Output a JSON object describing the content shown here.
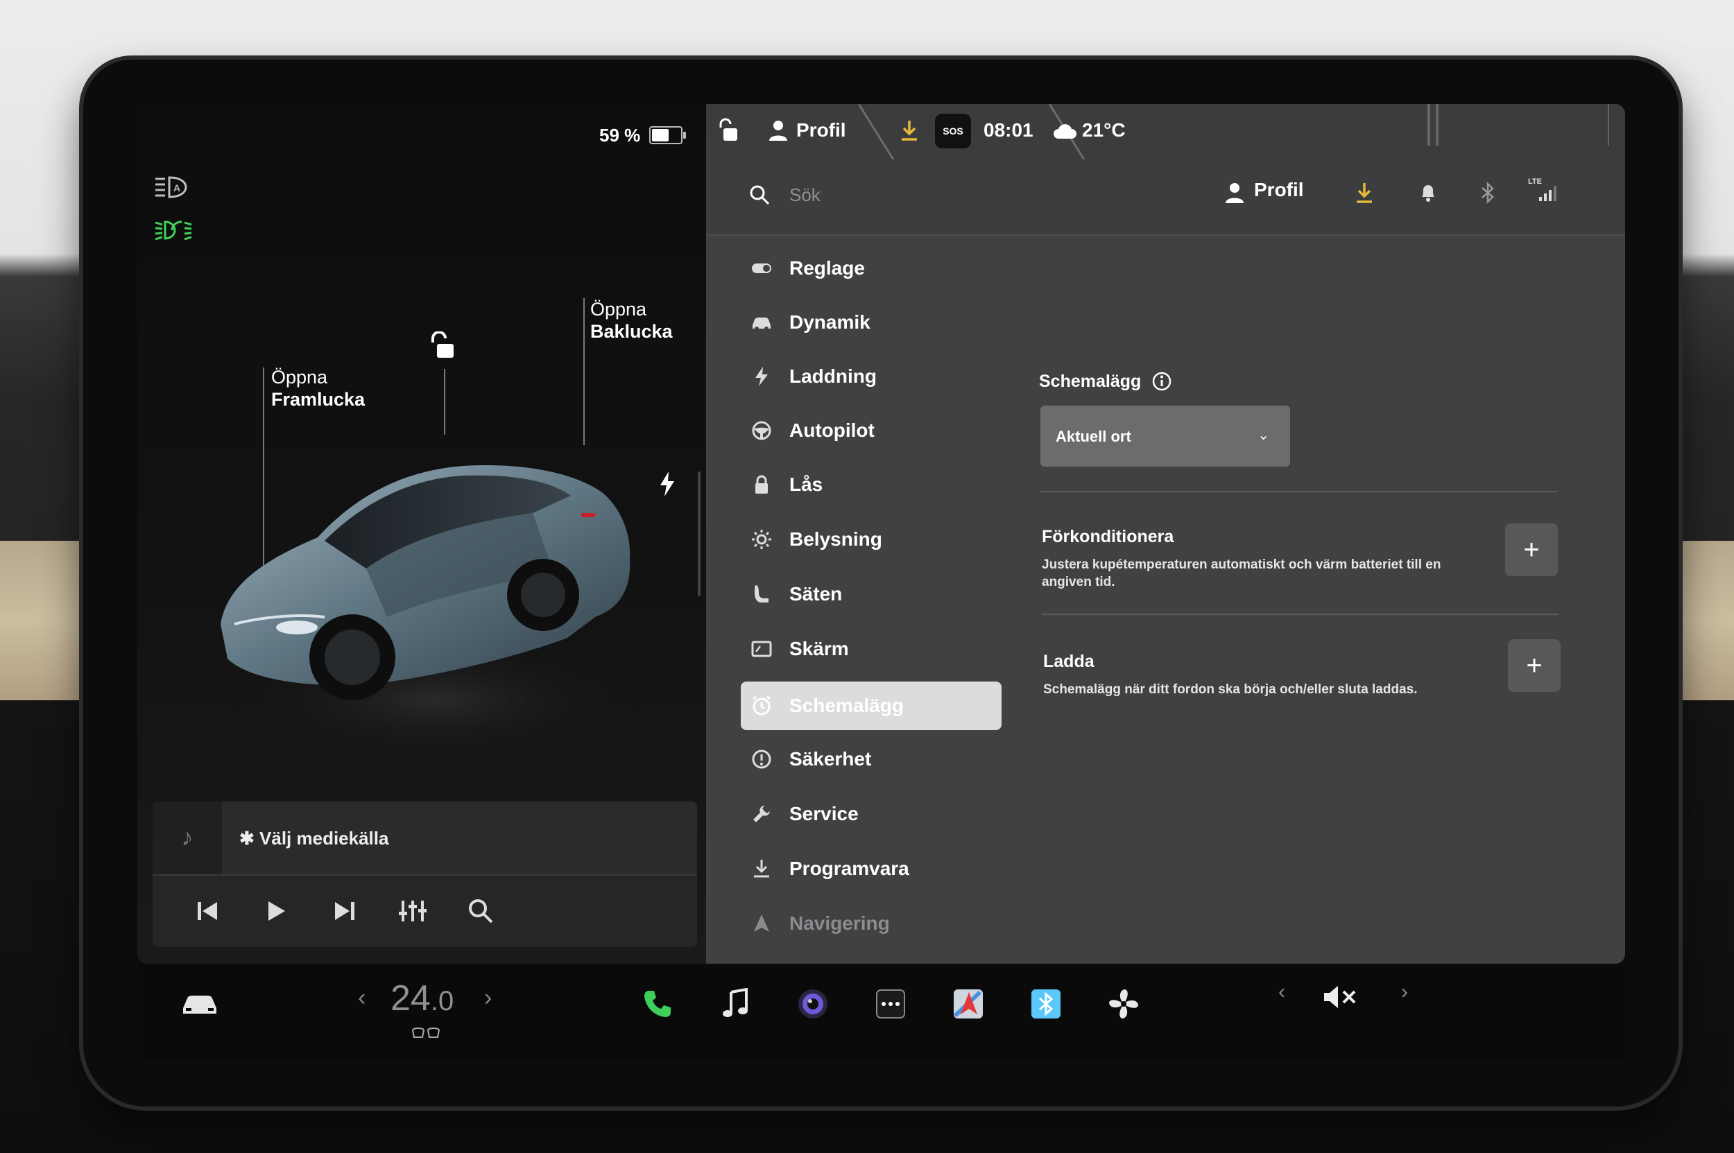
{
  "status_bar": {
    "battery_percent": "59 %",
    "battery_level": 0.59,
    "profile_label": "Profil",
    "sos_label": "SOS",
    "time": "08:01",
    "outside_temp": "21°C"
  },
  "car_panel": {
    "front_trunk_label_line1": "Öppna",
    "front_trunk_label_line2": "Framlucka",
    "rear_trunk_label_line1": "Öppna",
    "rear_trunk_label_line2": "Baklucka"
  },
  "media": {
    "source_label": "Välj mediekälla"
  },
  "header": {
    "search_placeholder": "Sök",
    "profile_label": "Profil",
    "lte_label": "LTE"
  },
  "nav": {
    "items": [
      {
        "label": "Reglage",
        "icon": "toggle-icon"
      },
      {
        "label": "Dynamik",
        "icon": "car-icon"
      },
      {
        "label": "Laddning",
        "icon": "bolt-icon"
      },
      {
        "label": "Autopilot",
        "icon": "steering-wheel-icon"
      },
      {
        "label": "Lås",
        "icon": "lock-icon"
      },
      {
        "label": "Belysning",
        "icon": "sun-icon"
      },
      {
        "label": "Säten",
        "icon": "seat-icon"
      },
      {
        "label": "Skärm",
        "icon": "display-icon"
      },
      {
        "label": "Schemalägg",
        "icon": "clock-icon",
        "active": true
      },
      {
        "label": "Säkerhet",
        "icon": "alert-icon"
      },
      {
        "label": "Service",
        "icon": "wrench-icon"
      },
      {
        "label": "Programvara",
        "icon": "download-icon"
      },
      {
        "label": "Navigering",
        "icon": "navigation-icon"
      }
    ]
  },
  "schedule": {
    "title": "Schemalägg",
    "location_value": "Aktuell ort",
    "precondition_title": "Förkonditionera",
    "precondition_desc_line1": "Justera kupétemperaturen automatiskt och värm batteriet till en",
    "precondition_desc_line2": "angiven tid.",
    "charge_title": "Ladda",
    "charge_desc": "Schemalägg när ditt fordon ska börja och/eller sluta laddas."
  },
  "dock": {
    "cabin_temp_whole": "24",
    "cabin_temp_decimal": ".0"
  },
  "colors": {
    "active_nav_bg": "#dcdcdc",
    "download_accent": "#e8b93a",
    "phone_green": "#3ecf5a",
    "bluetooth_blue": "#5ac8fa",
    "headlight_green": "#3fd45a"
  }
}
